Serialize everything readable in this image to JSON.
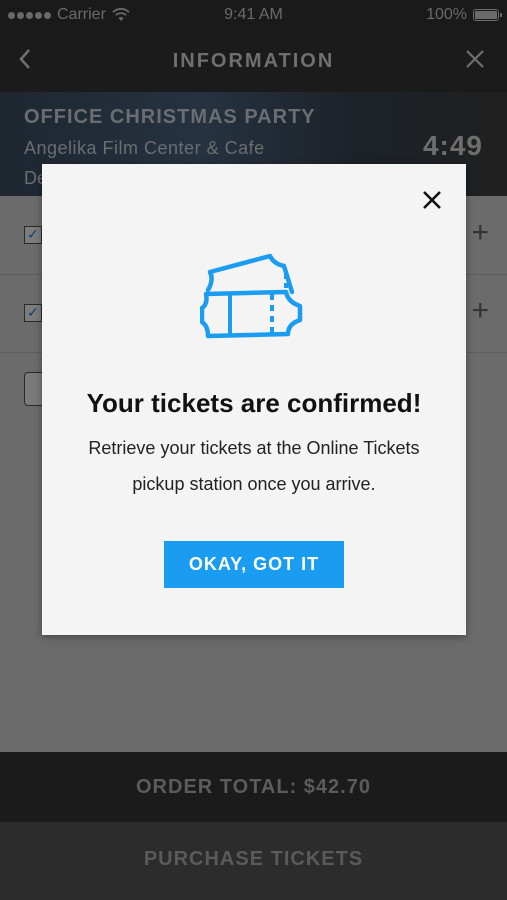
{
  "status_bar": {
    "carrier": "Carrier",
    "time": "9:41 AM",
    "battery": "100%",
    "wifi_icon": "wifi-icon",
    "battery_icon": "battery-icon"
  },
  "nav": {
    "title": "INFORMATION",
    "back_icon": "chevron-left-icon",
    "close_icon": "close-icon"
  },
  "event": {
    "title": "OFFICE CHRISTMAS PARTY",
    "venue": "Angelika Film Center & Cafe",
    "date_partial": "De",
    "countdown": "4:49"
  },
  "rows": [
    {
      "checked": true,
      "action_icon": "plus-icon"
    },
    {
      "checked": true,
      "action_icon": "plus-icon"
    },
    {
      "payment_icon": "apple-pay-icon"
    }
  ],
  "footer": {
    "order_total": "ORDER TOTAL: $42.70",
    "purchase_label": "PURCHASE TICKETS"
  },
  "modal": {
    "title": "Your tickets are confirmed!",
    "message": "Retrieve your tickets at the Online Tickets pickup station once you arrive.",
    "button_label": "OKAY, GOT IT",
    "icon": "tickets-icon",
    "close_icon": "close-icon",
    "accent_color": "#1a9cf0"
  },
  "colors": {
    "overlay": "#6b6b6b",
    "accent": "#1a9cf0",
    "modal_bg": "#f4f4f4"
  }
}
